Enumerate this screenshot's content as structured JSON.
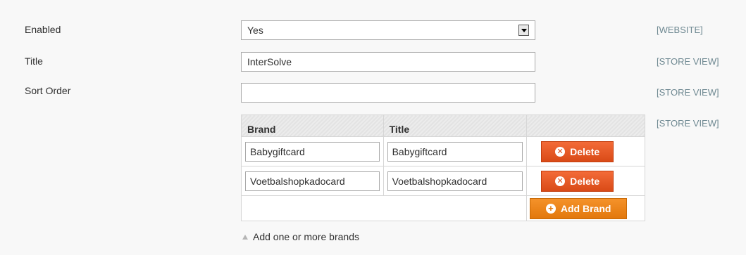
{
  "fields": {
    "enabled": {
      "label": "Enabled",
      "value": "Yes",
      "scope": "[WEBSITE]"
    },
    "title": {
      "label": "Title",
      "value": "InterSolve",
      "scope": "[STORE VIEW]"
    },
    "sort_order": {
      "label": "Sort Order",
      "value": "",
      "scope": "[STORE VIEW]"
    }
  },
  "brands": {
    "scope": "[STORE VIEW]",
    "headers": {
      "brand": "Brand",
      "title": "Title"
    },
    "rows": [
      {
        "brand": "Babygiftcard",
        "title": "Babygiftcard",
        "delete_label": "Delete"
      },
      {
        "brand": "Voetbalshopkadocard",
        "title": "Voetbalshopkadocard",
        "delete_label": "Delete"
      }
    ],
    "add_label": "Add Brand",
    "note": "Add one or more brands"
  },
  "icons": {
    "delete": "close-circle-icon",
    "add": "plus-circle-icon",
    "note": "triangle-up-icon",
    "select": "chevron-down-icon"
  },
  "colors": {
    "delete_button": "#eb5e27",
    "add_button": "#f18a1e",
    "scope_text": "#6f8992"
  }
}
